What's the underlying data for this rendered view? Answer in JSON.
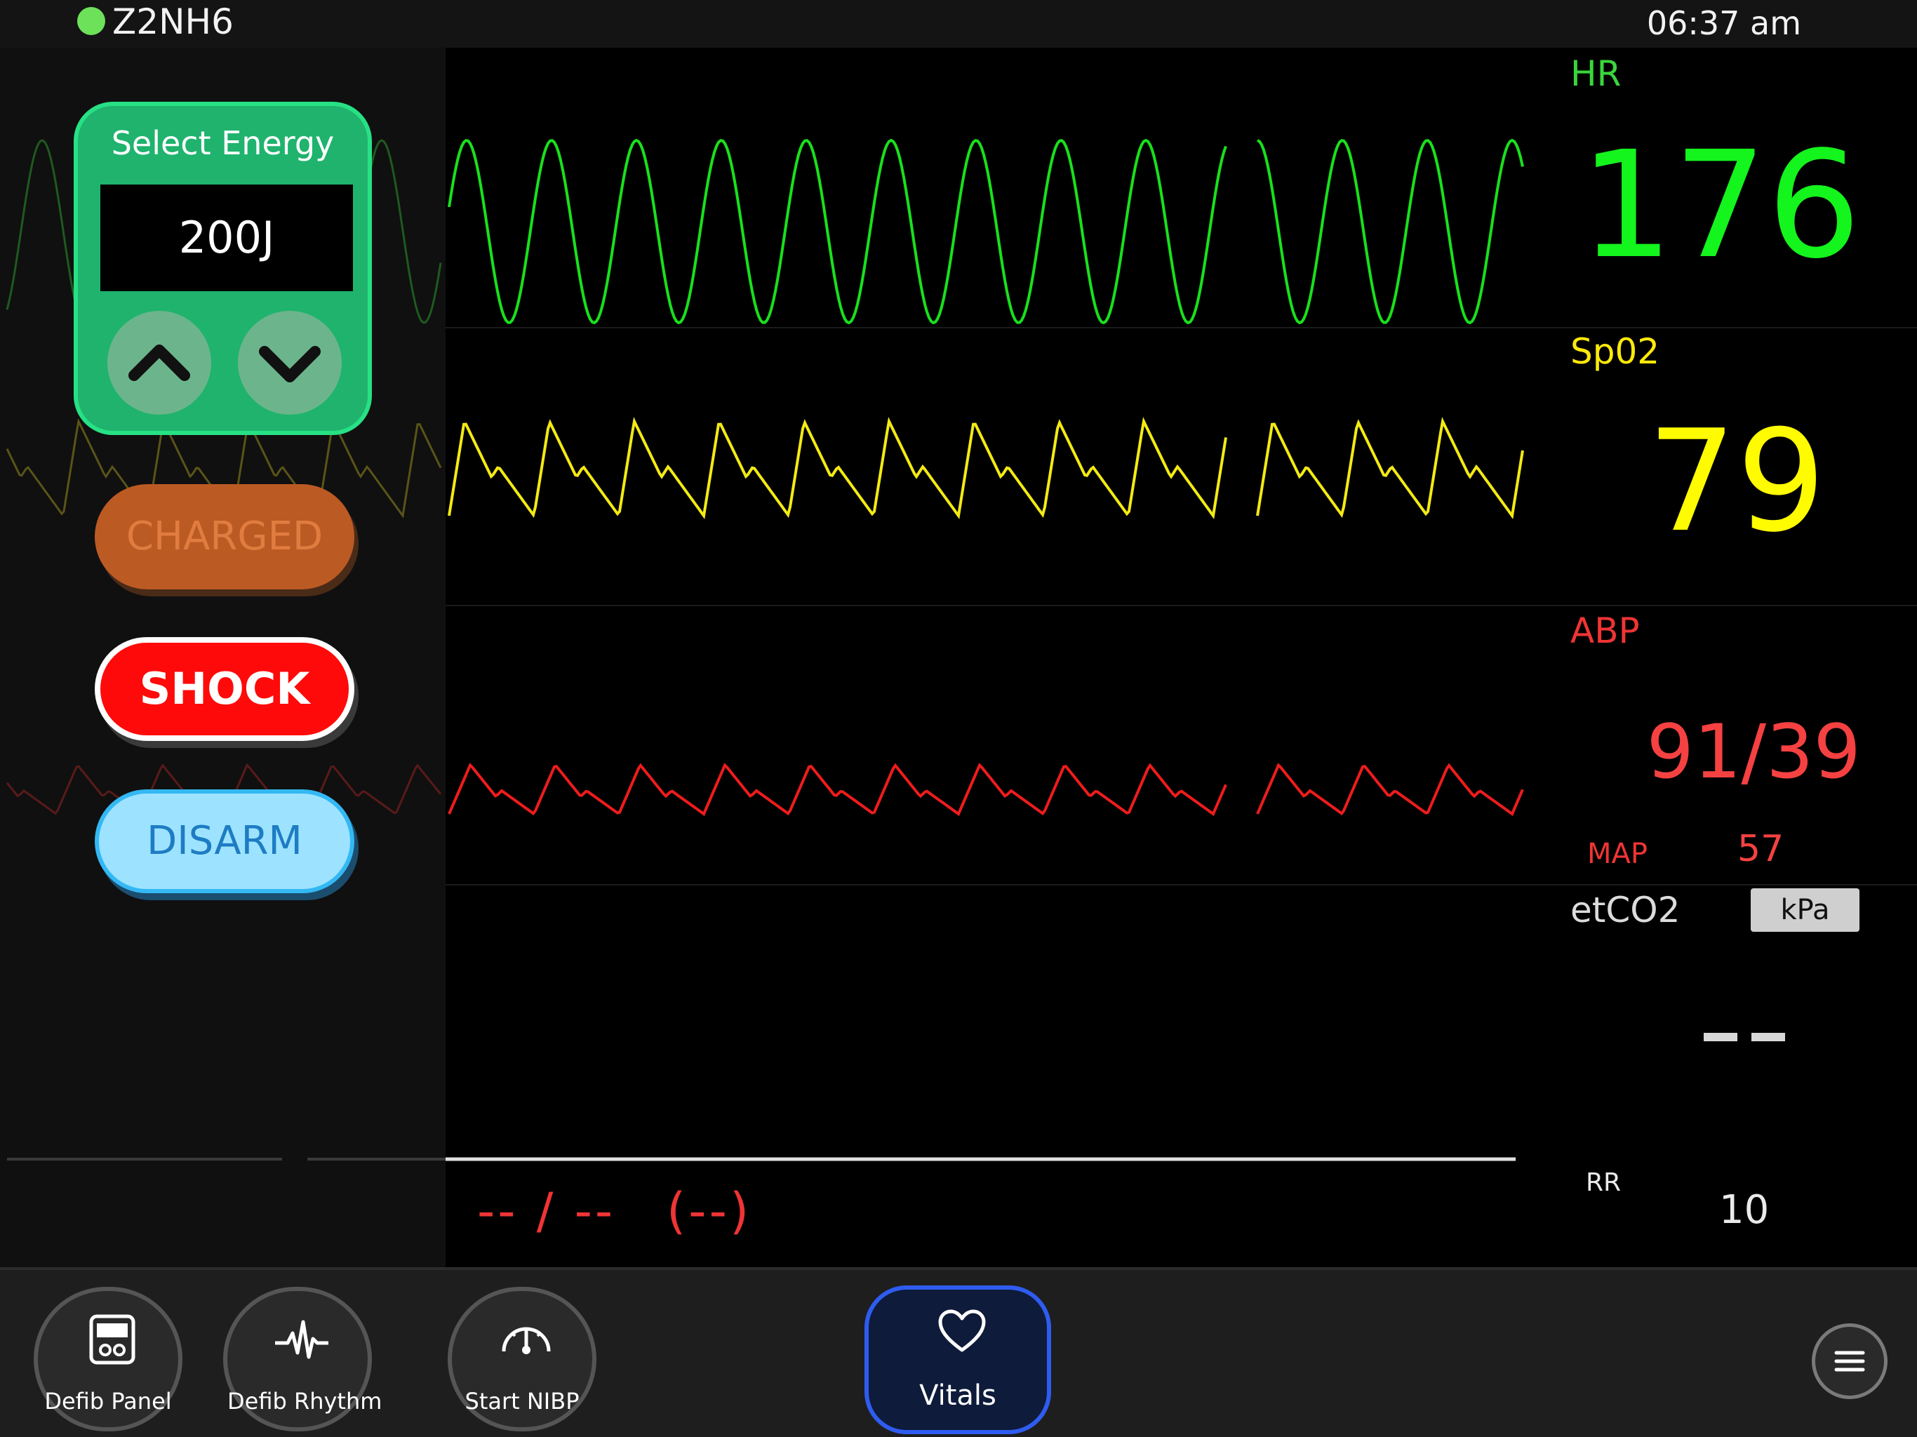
{
  "status": {
    "id": "Z2NH6",
    "time": "06:37 am",
    "connected_color": "#6de15a"
  },
  "energy": {
    "title": "Select Energy",
    "value": "200J",
    "up_icon": "chevron-up-icon",
    "down_icon": "chevron-down-icon"
  },
  "buttons": {
    "charged": "CHARGED",
    "shock": "SHOCK",
    "disarm": "DISARM"
  },
  "vitals": {
    "hr": {
      "label": "HR",
      "value": "176",
      "color": "#14f41d"
    },
    "spo2": {
      "label": "Sp02",
      "value": "79",
      "color": "#fffb00"
    },
    "abp": {
      "label": "ABP",
      "value": "91/39",
      "map_label": "MAP",
      "map_value": "57",
      "color": "#f54141"
    },
    "etco2": {
      "label": "etCO2",
      "unit": "kPa",
      "value": "--",
      "rr_label": "RR",
      "rr_value": "10"
    }
  },
  "nibp": {
    "value": "-- / --",
    "mean": "(--)"
  },
  "toolbar": {
    "defib_panel": "Defib Panel",
    "defib_rhythm": "Defib Rhythm",
    "start_nibp": "Start NIBP",
    "vitals": "Vitals",
    "vitals_accent": "#2f5cf0"
  }
}
